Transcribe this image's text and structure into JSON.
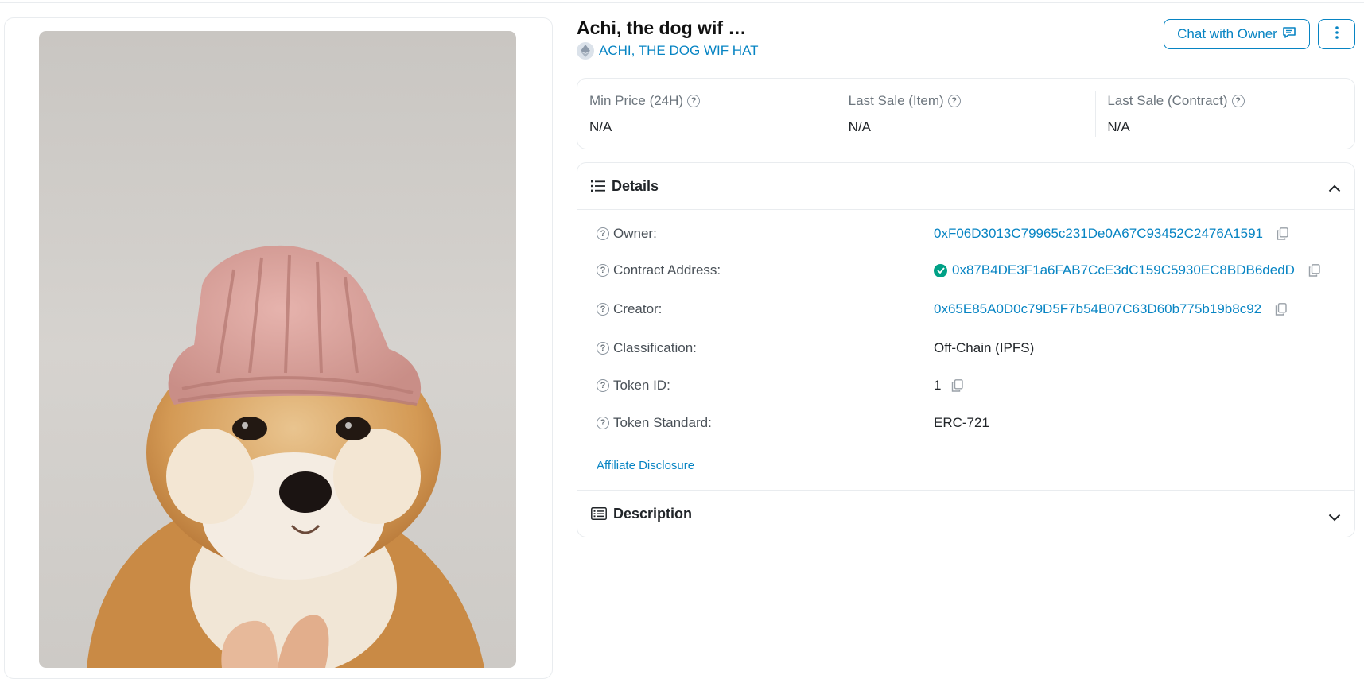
{
  "nft": {
    "title": "Achi, the dog wif …",
    "collection": "ACHI, THE DOG WIF HAT",
    "collection_icon": "ethereum-icon",
    "image_alt": "Shiba puppy wearing a pink knitted hat"
  },
  "actions": {
    "chat_label": "Chat with Owner",
    "chat_icon": "chat-bubble-icon",
    "more_icon": "vertical-ellipsis-icon"
  },
  "stats": [
    {
      "label": "Min Price (24H)",
      "value": "N/A"
    },
    {
      "label": "Last Sale (Item)",
      "value": "N/A"
    },
    {
      "label": "Last Sale (Contract)",
      "value": "N/A"
    }
  ],
  "details": {
    "heading": "Details",
    "rows": [
      {
        "label": "Owner:",
        "value": "0xF06D3013C79965c231De0A67C93452C2476A1591"
      },
      {
        "label": "Contract Address:",
        "value": "0x87B4DE3F1a6FAB7CcE3dC159C5930EC8BDB6dedD",
        "verified": true
      },
      {
        "label": "Creator:",
        "value": "0x65E85A0D0c79D5F7b54B07C63D60b775b19b8c92"
      },
      {
        "label": "Classification:",
        "value": "Off-Chain (IPFS)"
      },
      {
        "label": "Token ID:",
        "value": "1"
      },
      {
        "label": "Token Standard:",
        "value": "ERC-721"
      }
    ],
    "affiliate_label": "Affiliate Disclosure"
  },
  "description": {
    "heading": "Description"
  },
  "colors": {
    "link": "#0784c3",
    "border": "#e9ecef",
    "verified": "#00a186"
  }
}
